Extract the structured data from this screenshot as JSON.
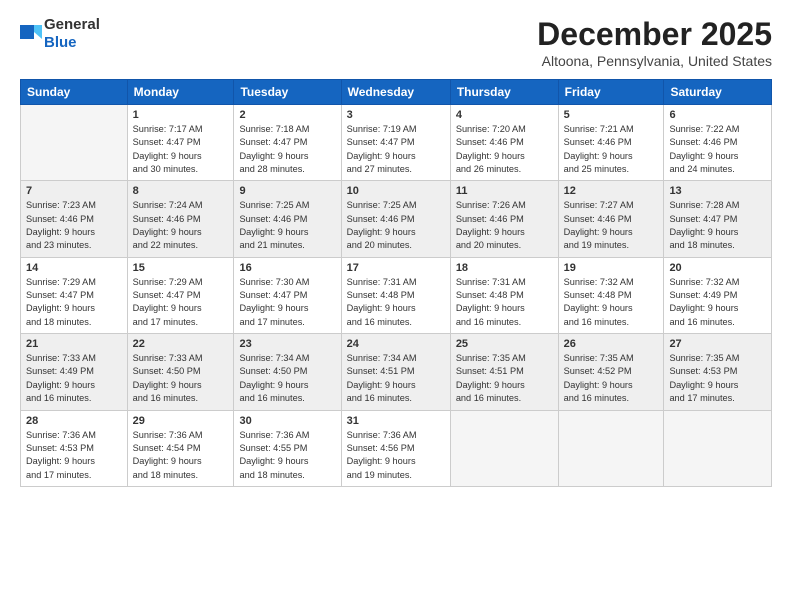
{
  "header": {
    "logo_general": "General",
    "logo_blue": "Blue",
    "month_year": "December 2025",
    "location": "Altoona, Pennsylvania, United States"
  },
  "days_of_week": [
    "Sunday",
    "Monday",
    "Tuesday",
    "Wednesday",
    "Thursday",
    "Friday",
    "Saturday"
  ],
  "weeks": [
    [
      {
        "day": "",
        "info": ""
      },
      {
        "day": "1",
        "info": "Sunrise: 7:17 AM\nSunset: 4:47 PM\nDaylight: 9 hours\nand 30 minutes."
      },
      {
        "day": "2",
        "info": "Sunrise: 7:18 AM\nSunset: 4:47 PM\nDaylight: 9 hours\nand 28 minutes."
      },
      {
        "day": "3",
        "info": "Sunrise: 7:19 AM\nSunset: 4:47 PM\nDaylight: 9 hours\nand 27 minutes."
      },
      {
        "day": "4",
        "info": "Sunrise: 7:20 AM\nSunset: 4:46 PM\nDaylight: 9 hours\nand 26 minutes."
      },
      {
        "day": "5",
        "info": "Sunrise: 7:21 AM\nSunset: 4:46 PM\nDaylight: 9 hours\nand 25 minutes."
      },
      {
        "day": "6",
        "info": "Sunrise: 7:22 AM\nSunset: 4:46 PM\nDaylight: 9 hours\nand 24 minutes."
      }
    ],
    [
      {
        "day": "7",
        "info": "Sunrise: 7:23 AM\nSunset: 4:46 PM\nDaylight: 9 hours\nand 23 minutes."
      },
      {
        "day": "8",
        "info": "Sunrise: 7:24 AM\nSunset: 4:46 PM\nDaylight: 9 hours\nand 22 minutes."
      },
      {
        "day": "9",
        "info": "Sunrise: 7:25 AM\nSunset: 4:46 PM\nDaylight: 9 hours\nand 21 minutes."
      },
      {
        "day": "10",
        "info": "Sunrise: 7:25 AM\nSunset: 4:46 PM\nDaylight: 9 hours\nand 20 minutes."
      },
      {
        "day": "11",
        "info": "Sunrise: 7:26 AM\nSunset: 4:46 PM\nDaylight: 9 hours\nand 20 minutes."
      },
      {
        "day": "12",
        "info": "Sunrise: 7:27 AM\nSunset: 4:46 PM\nDaylight: 9 hours\nand 19 minutes."
      },
      {
        "day": "13",
        "info": "Sunrise: 7:28 AM\nSunset: 4:47 PM\nDaylight: 9 hours\nand 18 minutes."
      }
    ],
    [
      {
        "day": "14",
        "info": "Sunrise: 7:29 AM\nSunset: 4:47 PM\nDaylight: 9 hours\nand 18 minutes."
      },
      {
        "day": "15",
        "info": "Sunrise: 7:29 AM\nSunset: 4:47 PM\nDaylight: 9 hours\nand 17 minutes."
      },
      {
        "day": "16",
        "info": "Sunrise: 7:30 AM\nSunset: 4:47 PM\nDaylight: 9 hours\nand 17 minutes."
      },
      {
        "day": "17",
        "info": "Sunrise: 7:31 AM\nSunset: 4:48 PM\nDaylight: 9 hours\nand 16 minutes."
      },
      {
        "day": "18",
        "info": "Sunrise: 7:31 AM\nSunset: 4:48 PM\nDaylight: 9 hours\nand 16 minutes."
      },
      {
        "day": "19",
        "info": "Sunrise: 7:32 AM\nSunset: 4:48 PM\nDaylight: 9 hours\nand 16 minutes."
      },
      {
        "day": "20",
        "info": "Sunrise: 7:32 AM\nSunset: 4:49 PM\nDaylight: 9 hours\nand 16 minutes."
      }
    ],
    [
      {
        "day": "21",
        "info": "Sunrise: 7:33 AM\nSunset: 4:49 PM\nDaylight: 9 hours\nand 16 minutes."
      },
      {
        "day": "22",
        "info": "Sunrise: 7:33 AM\nSunset: 4:50 PM\nDaylight: 9 hours\nand 16 minutes."
      },
      {
        "day": "23",
        "info": "Sunrise: 7:34 AM\nSunset: 4:50 PM\nDaylight: 9 hours\nand 16 minutes."
      },
      {
        "day": "24",
        "info": "Sunrise: 7:34 AM\nSunset: 4:51 PM\nDaylight: 9 hours\nand 16 minutes."
      },
      {
        "day": "25",
        "info": "Sunrise: 7:35 AM\nSunset: 4:51 PM\nDaylight: 9 hours\nand 16 minutes."
      },
      {
        "day": "26",
        "info": "Sunrise: 7:35 AM\nSunset: 4:52 PM\nDaylight: 9 hours\nand 16 minutes."
      },
      {
        "day": "27",
        "info": "Sunrise: 7:35 AM\nSunset: 4:53 PM\nDaylight: 9 hours\nand 17 minutes."
      }
    ],
    [
      {
        "day": "28",
        "info": "Sunrise: 7:36 AM\nSunset: 4:53 PM\nDaylight: 9 hours\nand 17 minutes."
      },
      {
        "day": "29",
        "info": "Sunrise: 7:36 AM\nSunset: 4:54 PM\nDaylight: 9 hours\nand 18 minutes."
      },
      {
        "day": "30",
        "info": "Sunrise: 7:36 AM\nSunset: 4:55 PM\nDaylight: 9 hours\nand 18 minutes."
      },
      {
        "day": "31",
        "info": "Sunrise: 7:36 AM\nSunset: 4:56 PM\nDaylight: 9 hours\nand 19 minutes."
      },
      {
        "day": "",
        "info": ""
      },
      {
        "day": "",
        "info": ""
      },
      {
        "day": "",
        "info": ""
      }
    ]
  ]
}
